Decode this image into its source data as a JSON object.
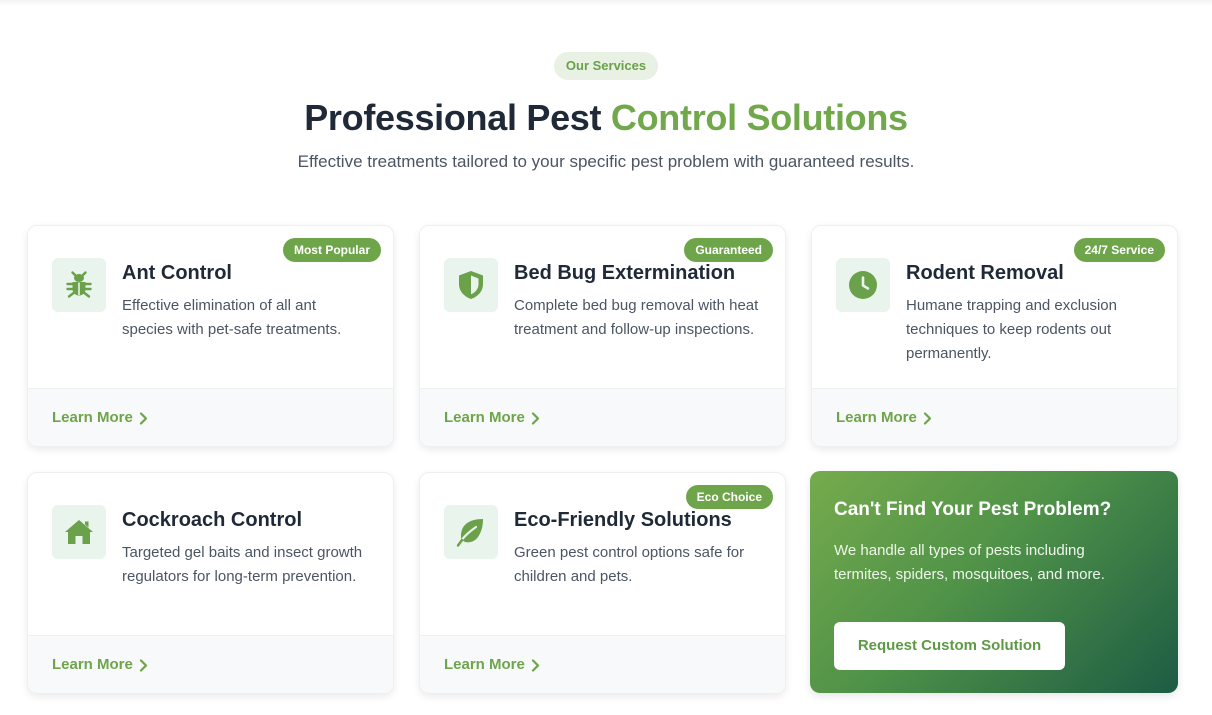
{
  "header": {
    "pill": "Our Services",
    "title_main": "Professional Pest",
    "title_accent": "Control Solutions",
    "subtitle": "Effective treatments tailored to your specific pest problem with guaranteed results."
  },
  "services": [
    {
      "title": "Ant Control",
      "description": "Effective elimination of all ant species with pet-safe treatments.",
      "badge": "Most Popular",
      "icon": "bug-icon",
      "link": "Learn More"
    },
    {
      "title": "Bed Bug Extermination",
      "description": "Complete bed bug removal with heat treatment and follow-up inspections.",
      "badge": "Guaranteed",
      "icon": "shield-icon",
      "link": "Learn More"
    },
    {
      "title": "Rodent Removal",
      "description": "Humane trapping and exclusion techniques to keep rodents out permanently.",
      "badge": "24/7 Service",
      "icon": "clock-icon",
      "link": "Learn More"
    },
    {
      "title": "Cockroach Control",
      "description": "Targeted gel baits and insect growth regulators for long-term prevention.",
      "badge": "",
      "icon": "home-icon",
      "link": "Learn More"
    },
    {
      "title": "Eco-Friendly Solutions",
      "description": "Green pest control options safe for children and pets.",
      "badge": "Eco Choice",
      "icon": "leaf-icon",
      "link": "Learn More"
    }
  ],
  "cta": {
    "title": "Can't Find Your Pest Problem?",
    "description": "We handle all types of pests including termites, spiders, mosquitoes, and more.",
    "button": "Request Custom Solution"
  },
  "colors": {
    "accent": "#72a84c",
    "badge": "#6fa54a",
    "icon_bg": "#e8f4ec",
    "cta_gradient_start": "#76ab4d",
    "cta_gradient_end": "#1d5c44"
  }
}
